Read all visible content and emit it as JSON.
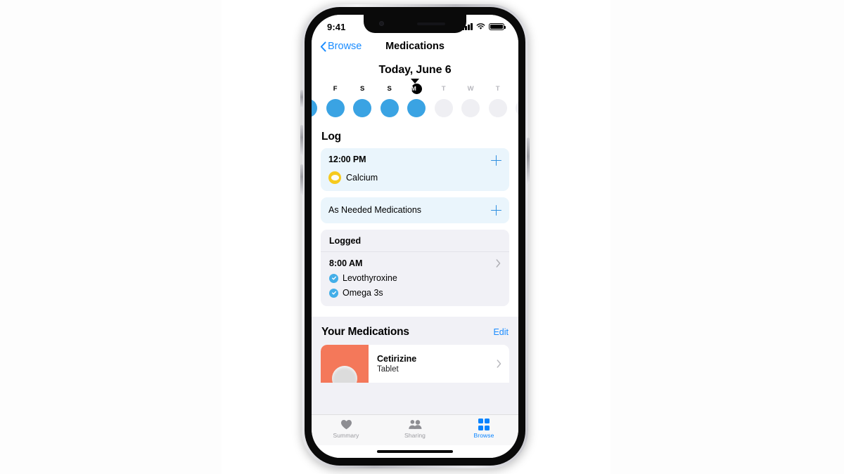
{
  "status_bar": {
    "time": "9:41",
    "cellular_icon": "signal-bars-icon",
    "wifi_icon": "wifi-icon",
    "battery_icon": "battery-icon"
  },
  "nav": {
    "back_label": "Browse",
    "back_icon": "chevron-left-icon",
    "title": "Medications"
  },
  "date_header": {
    "title": "Today, June 6",
    "caret_icon": "caret-down-icon"
  },
  "day_strip": {
    "days": [
      {
        "letter": "F",
        "state": "past",
        "dot": "filled",
        "today": false
      },
      {
        "letter": "S",
        "state": "past",
        "dot": "filled",
        "today": false
      },
      {
        "letter": "S",
        "state": "past",
        "dot": "filled",
        "today": false
      },
      {
        "letter": "M",
        "state": "today",
        "dot": "filled",
        "today": true
      },
      {
        "letter": "T",
        "state": "future",
        "dot": "empty",
        "today": false
      },
      {
        "letter": "W",
        "state": "future",
        "dot": "empty",
        "today": false
      },
      {
        "letter": "T",
        "state": "future",
        "dot": "empty",
        "today": false
      }
    ]
  },
  "log": {
    "section_title": "Log",
    "scheduled_card": {
      "time": "12:00 PM",
      "add_icon": "plus-icon",
      "medications": [
        {
          "name": "Calcium",
          "icon": "pill-capsule-icon",
          "color": "#f6ca1e"
        }
      ]
    },
    "as_needed_card": {
      "label": "As Needed Medications",
      "add_icon": "plus-icon"
    },
    "logged_card": {
      "header": "Logged",
      "time": "8:00 AM",
      "disclosure_icon": "chevron-right-icon",
      "items": [
        {
          "name": "Levothyroxine",
          "icon": "check-circle-icon",
          "checked": true
        },
        {
          "name": "Omega 3s",
          "icon": "check-circle-icon",
          "checked": true
        }
      ]
    }
  },
  "your_medications": {
    "title": "Your Medications",
    "edit_label": "Edit",
    "items": [
      {
        "name": "Cetirizine",
        "form": "Tablet",
        "thumb_color": "#f4785a",
        "thumb_icon": "tablet-pill-icon",
        "disclosure_icon": "chevron-right-icon"
      }
    ]
  },
  "tab_bar": {
    "tabs": [
      {
        "label": "Summary",
        "icon": "heart-icon",
        "active": false
      },
      {
        "label": "Sharing",
        "icon": "people-icon",
        "active": false
      },
      {
        "label": "Browse",
        "icon": "grid-icon",
        "active": true
      }
    ]
  },
  "colors": {
    "accent_blue": "#0a84ff",
    "link_blue": "#1a8cff",
    "dot_blue": "#3aa3e3",
    "card_tint": "#eaf5fc",
    "grouped_bg": "#f1f1f6",
    "pill_yellow": "#f6ca1e",
    "med_orange": "#f4785a"
  }
}
